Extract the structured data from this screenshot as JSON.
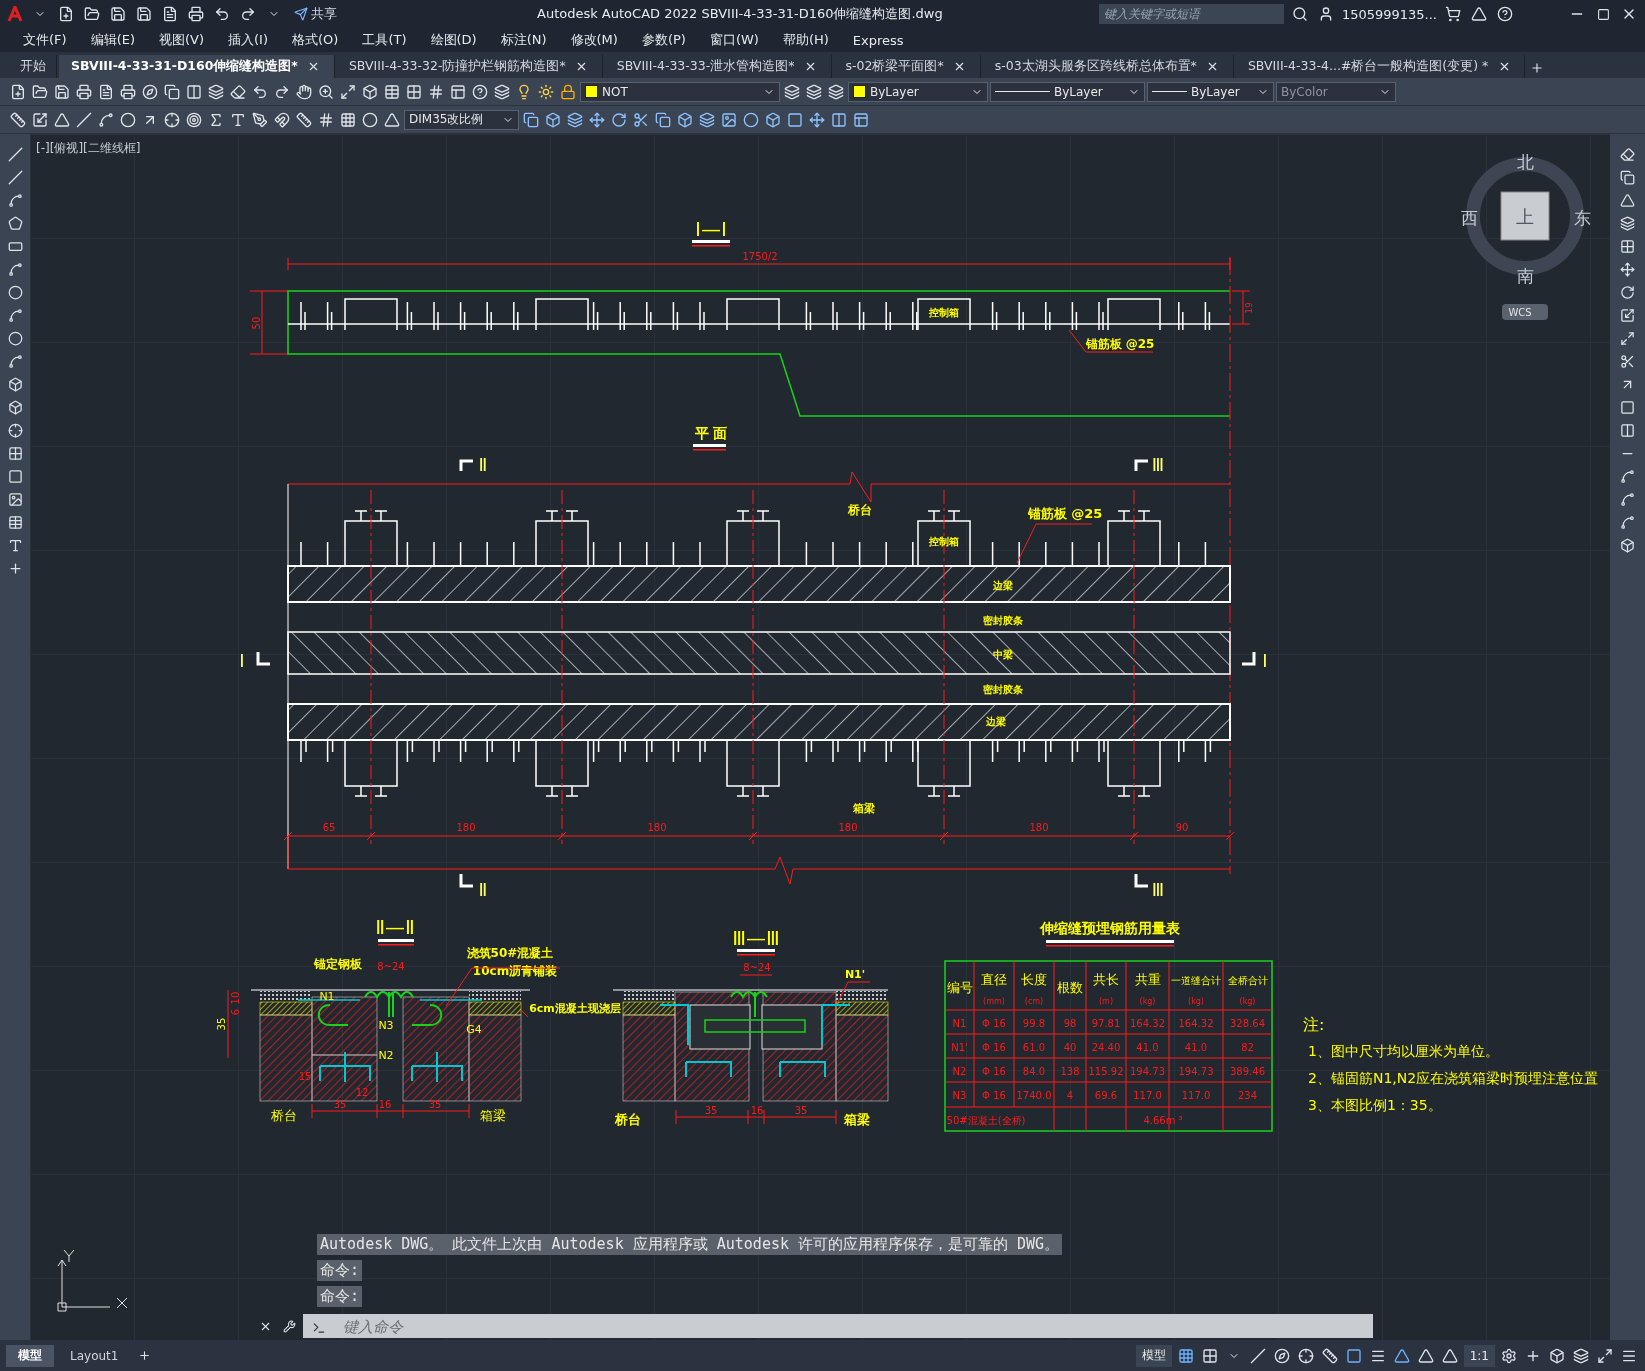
{
  "title_bar": {
    "share": "共享",
    "title": "Autodesk AutoCAD 2022    SBVIII-4-33-31-D160伸缩缝构造图.dwg",
    "search_placeholder": "键入关键字或短语",
    "user": "1505999135..."
  },
  "menu": [
    "文件(F)",
    "编辑(E)",
    "视图(V)",
    "插入(I)",
    "格式(O)",
    "工具(T)",
    "绘图(D)",
    "标注(N)",
    "修改(M)",
    "参数(P)",
    "窗口(W)",
    "帮助(H)",
    "Express"
  ],
  "file_tabs": [
    {
      "label": "开始",
      "selected": false,
      "closable": false
    },
    {
      "label": "SBVIII-4-33-31-D160伸缩缝构造图*",
      "selected": true,
      "closable": true
    },
    {
      "label": "SBVIII-4-33-32-防撞护栏钢筋构造图*",
      "selected": false,
      "closable": true
    },
    {
      "label": "SBVIII-4-33-33-泄水管构造图*",
      "selected": false,
      "closable": true
    },
    {
      "label": "s-02桥梁平面图*",
      "selected": false,
      "closable": true
    },
    {
      "label": "s-03太湖头服务区跨线桥总体布置*",
      "selected": false,
      "closable": true
    },
    {
      "label": "SBVIII-4-33-4...#桥台一般构造图(变更) *",
      "selected": false,
      "closable": true
    }
  ],
  "properties": {
    "layer": "NOT",
    "color_control": "ByLayer",
    "linetype": "ByLayer",
    "lineweight": "ByLayer",
    "plot_style": "ByColor"
  },
  "dim_style": "DIM35改比例",
  "viewport_label": "[-][俯视][二维线框]",
  "viewcube": {
    "north": "北",
    "south": "南",
    "east": "东",
    "west": "西",
    "top": "上",
    "wcs": "WCS"
  },
  "section_1": {
    "title": "Ⅰ—Ⅰ",
    "length_dim": "1750/2",
    "height_dim": "50",
    "side_dim": "19",
    "box_label": "控制箱",
    "leader_label": "锚筋板  @25"
  },
  "plan": {
    "title": "平  面",
    "marks": [
      "Ⅱ",
      "Ⅲ",
      "Ⅰ",
      "Ⅰ",
      "Ⅱ",
      "Ⅲ"
    ],
    "labels": [
      "桥台",
      "控制箱",
      "锚筋板  @25",
      "边梁",
      "密封胶条",
      "中梁",
      "密封胶条",
      "边梁",
      "箱梁"
    ],
    "dims": [
      "65",
      "180",
      "180",
      "180",
      "180",
      "90"
    ]
  },
  "section_2": {
    "title": "Ⅱ—Ⅱ",
    "labels": [
      "锚定钢板",
      "浇筑50#混凝土",
      "10cm沥青铺装",
      "6cm混凝土现浇层",
      "N1",
      "N3",
      "N2",
      "G4",
      "桥台",
      "箱梁"
    ],
    "red_labels": [
      "8~24",
      "6",
      "10",
      "15",
      "12"
    ],
    "depth": "35",
    "dims": [
      "35",
      "16",
      "35"
    ]
  },
  "section_3": {
    "title": "Ⅲ—Ⅲ",
    "labels": [
      "N1'",
      "桥台",
      "箱梁"
    ],
    "red_labels": [
      "8~24"
    ],
    "dims": [
      "35",
      "16",
      "35"
    ]
  },
  "rebar_table": {
    "title": "伸缩缝预埋钢筋用量表",
    "columns": [
      {
        "name": "编号"
      },
      {
        "name": "直径",
        "unit": "(mm)"
      },
      {
        "name": "长度",
        "unit": "(cm)"
      },
      {
        "name": "根数"
      },
      {
        "name": "共长",
        "unit": "(m)"
      },
      {
        "name": "共重",
        "unit": "(kg)"
      },
      {
        "name": "一道缝合计",
        "unit": "(kg)"
      },
      {
        "name": "全桥合计",
        "unit": "(kg)"
      }
    ],
    "rows": [
      [
        "N1",
        "Φ 16",
        "99.8",
        "98",
        "97.81",
        "164.32",
        "164.32",
        "328.64"
      ],
      [
        "N1'",
        "Φ 16",
        "61.0",
        "40",
        "24.40",
        "41.0",
        "41.0",
        "82"
      ],
      [
        "N2",
        "Φ 16",
        "84.0",
        "138",
        "115.92",
        "194.73",
        "194.73",
        "389.46"
      ],
      [
        "N3",
        "Φ 16",
        "1740.0",
        "4",
        "69.6",
        "117.0",
        "117.0",
        "234"
      ]
    ],
    "total": {
      "label": "50#混凝土(全桥)",
      "value": "4.66m ³"
    }
  },
  "notes": {
    "heading": "注:",
    "items": [
      "1、图中尺寸均以厘米为单位。",
      "2、锚固筋N1,N2应在浇筑箱梁时预埋注意位置",
      "3、本图比例1：35。"
    ]
  },
  "command_line": {
    "history": [
      "Autodesk DWG。  此文件上次由 Autodesk 应用程序或 Autodesk 许可的应用程序保存，是可靠的 DWG。",
      "命令:",
      "命令:"
    ],
    "placeholder": "键入命令"
  },
  "layout_tabs": [
    {
      "label": "模型",
      "selected": true
    },
    {
      "label": "Layout1",
      "selected": false
    }
  ],
  "status_bar": {
    "model": "模型",
    "scale": "1:1"
  }
}
